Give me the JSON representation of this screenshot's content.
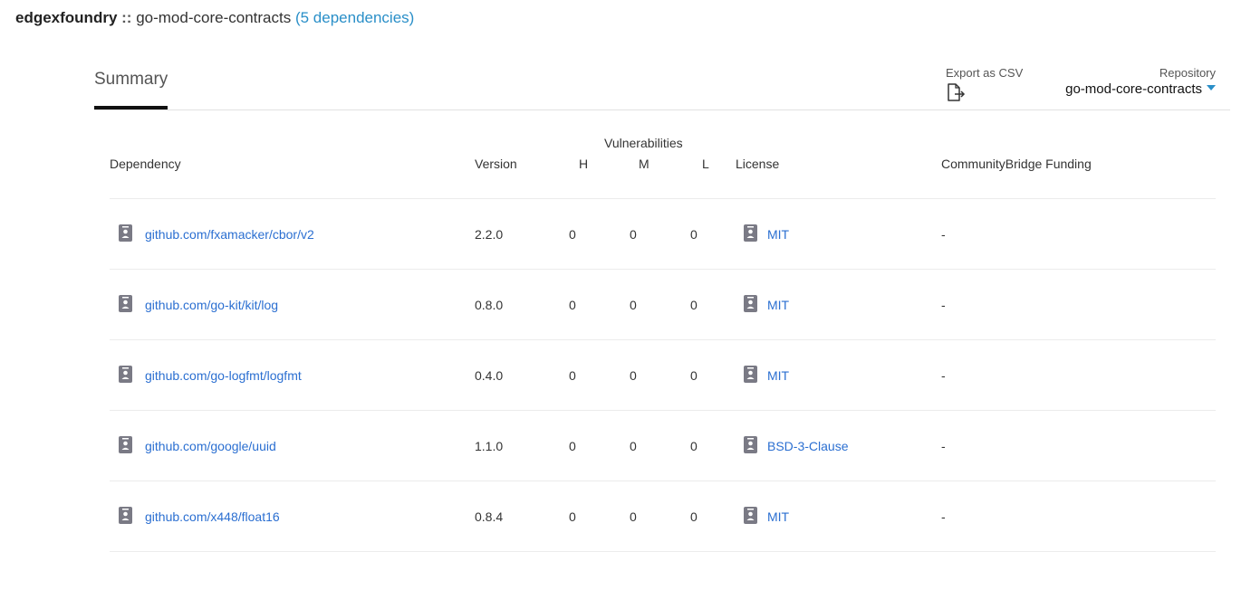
{
  "header": {
    "org": "edgexfoundry",
    "separator": "::",
    "repo": "go-mod-core-contracts",
    "deps_count": "(5 dependencies)"
  },
  "tabs": {
    "summary": "Summary"
  },
  "export": {
    "label": "Export as CSV",
    "icon": "export-file-icon"
  },
  "repository": {
    "label": "Repository",
    "selected": "go-mod-core-contracts"
  },
  "table": {
    "headers": {
      "dependency": "Dependency",
      "version": "Version",
      "vulnerabilities": "Vulnerabilities",
      "h": "H",
      "m": "M",
      "l": "L",
      "license": "License",
      "funding": "CommunityBridge Funding"
    },
    "rows": [
      {
        "dependency": "github.com/fxamacker/cbor/v2",
        "version": "2.2.0",
        "h": "0",
        "m": "0",
        "l": "0",
        "license": "MIT",
        "funding": "-"
      },
      {
        "dependency": "github.com/go-kit/kit/log",
        "version": "0.8.0",
        "h": "0",
        "m": "0",
        "l": "0",
        "license": "MIT",
        "funding": "-"
      },
      {
        "dependency": "github.com/go-logfmt/logfmt",
        "version": "0.4.0",
        "h": "0",
        "m": "0",
        "l": "0",
        "license": "MIT",
        "funding": "-"
      },
      {
        "dependency": "github.com/google/uuid",
        "version": "1.1.0",
        "h": "0",
        "m": "0",
        "l": "0",
        "license": "BSD-3-Clause",
        "funding": "-"
      },
      {
        "dependency": "github.com/x448/float16",
        "version": "0.8.4",
        "h": "0",
        "m": "0",
        "l": "0",
        "license": "MIT",
        "funding": "-"
      }
    ]
  },
  "colors": {
    "link": "#2b6fd1",
    "accent": "#2a8fc8",
    "icon": "#7a7a85"
  }
}
